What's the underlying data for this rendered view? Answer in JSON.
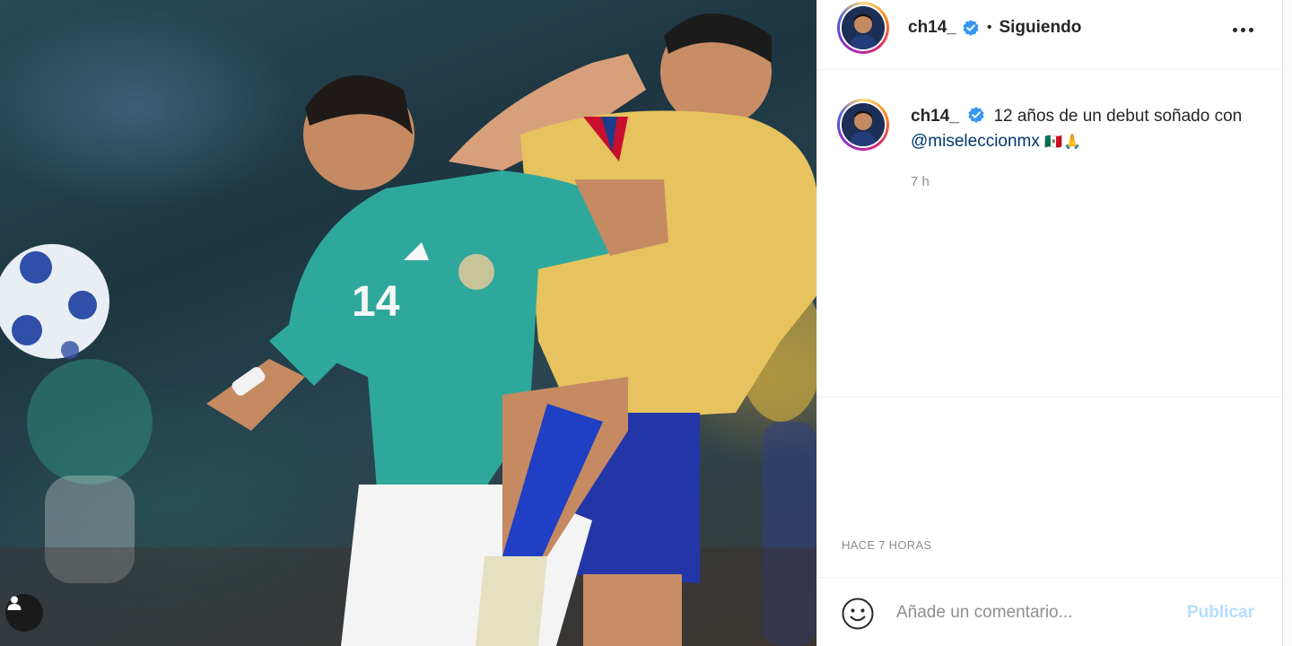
{
  "post": {
    "username": "ch14_",
    "verified": true,
    "separator": "•",
    "follow_state": "Siguiendo",
    "more_icon": "more-horizontal-icon",
    "caption": {
      "username": "ch14_",
      "text": "12 años de un debut soñado con",
      "mention": "@miseleccionmx",
      "emoji": "🇲🇽🙏",
      "time": "7 h"
    },
    "timestamp": "HACE 7 HORAS"
  },
  "comment": {
    "placeholder": "Añade un comentario...",
    "publish_label": "Publicar",
    "emoji_icon": "smiley-icon"
  },
  "photo": {
    "user_tag_icon": "user-icon",
    "jersey_number": "14"
  },
  "colors": {
    "verified": "#3897f0",
    "link": "#00376b",
    "publish_disabled": "#b2dffc",
    "mexico_jersey": "#2fa89c",
    "colombia_jersey": "#e3c15a"
  }
}
